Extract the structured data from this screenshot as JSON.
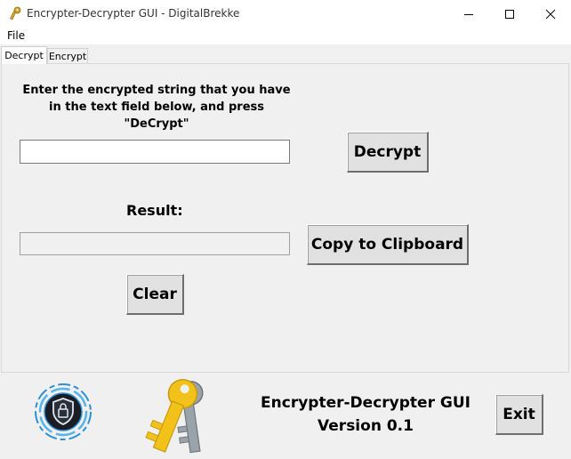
{
  "window": {
    "title": "Encrypter-Decrypter GUI - DigitalBrekke",
    "icons": [
      "app-key-icon",
      "minimize-icon",
      "maximize-icon",
      "close-icon"
    ]
  },
  "menu": {
    "file": "File"
  },
  "tabs": [
    {
      "label": "Decrypt",
      "active": true
    },
    {
      "label": "Encrypt",
      "active": false
    }
  ],
  "decrypt": {
    "instructions_line1": "Enter the encrypted string that you have",
    "instructions_line2": "in the text field below, and press \"DeCrypt\"",
    "input_value": "",
    "decrypt_button": "Decrypt",
    "result_label": "Result:",
    "result_value": "",
    "copy_button": "Copy to Clipboard",
    "clear_button": "Clear"
  },
  "footer": {
    "app_name": "Encrypter-Decrypter GUI",
    "version": "Version 0.1",
    "exit_button": "Exit",
    "logo_icon": "shield-logo-icon",
    "keys_icon": "keys-icon"
  },
  "colors": {
    "key_gold": "#f2c21a",
    "key_grey": "#9aa3aa",
    "logo_blue": "#2b8fd6"
  }
}
